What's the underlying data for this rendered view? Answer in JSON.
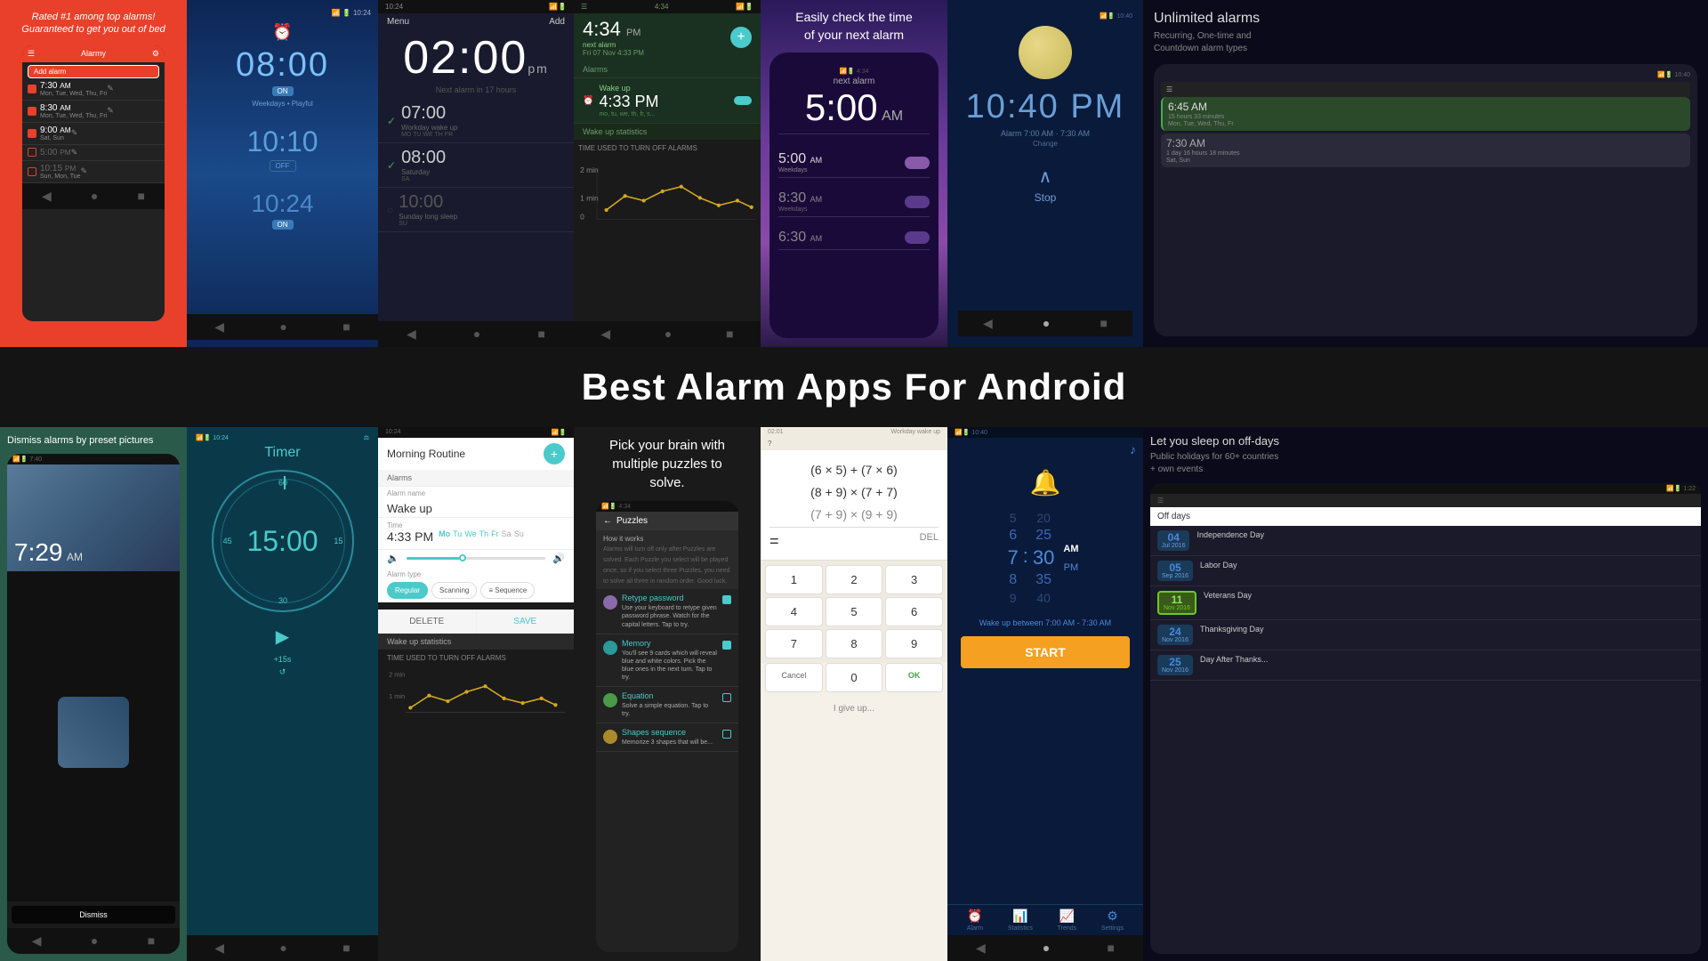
{
  "top": {
    "cell1": {
      "tagline": "Rated #1 among top alarms! Guaranteed to get you out of bed",
      "app_name": "Alarmy",
      "add_btn": "Add alarm",
      "alarms": [
        {
          "time": "7:30",
          "suffix": "AM",
          "days": "Mon, Tue, Wed, Thu, Fri",
          "checked": true
        },
        {
          "time": "8:30",
          "suffix": "AM",
          "days": "Mon, Tue, Wed, Thu, Fri",
          "checked": true
        },
        {
          "time": "9:00",
          "suffix": "AM",
          "days": "Sat, Sun",
          "checked": true
        },
        {
          "time": "5:00",
          "suffix": "PM",
          "days": "",
          "checked": false
        },
        {
          "time": "10:15",
          "suffix": "PM",
          "days": "Sun, Mon, Tue",
          "checked": false
        }
      ]
    },
    "cell2": {
      "time1": "08:00",
      "on1": "ON",
      "days1": "Weekdays • Playful",
      "time2": "10:10",
      "off": "OFF",
      "time3": "10:24",
      "on2": "ON"
    },
    "cell3": {
      "menu": "Menu",
      "add": "Add",
      "big_time": "02:00",
      "pm": "pm",
      "next_alarm": "Next alarm in 17 hours",
      "alarms": [
        {
          "time": "07:00",
          "label": "Workday wake up",
          "days": "MO TU WE TH FR",
          "checked": true
        },
        {
          "time": "08:00",
          "label": "Saturday",
          "days": "SA",
          "checked": true
        },
        {
          "time": "10:00",
          "label": "Sunday long sleep",
          "days": "SU",
          "checked": false
        }
      ]
    },
    "cell4": {
      "time": "4:34 PM",
      "next_alarm": "next alarm",
      "next_alarm_time": "Fri 07 Nov 4:33 PM",
      "alarms_label": "Alarms",
      "wakeup": "Wake up",
      "wakeup_time": "4:33 PM",
      "wakeup_days": "mo, tu, we, th, fr, s",
      "stats_label": "Wake up statistics",
      "chart_title": "TIME USED TO TURN OFF ALARMS"
    },
    "cell5": {
      "check_text": "Easily check the time\nof your next alarm",
      "big_time": "5:00",
      "am": "AM",
      "alarms": [
        {
          "time": "5:00",
          "suffix": "AM",
          "label": "Weekdays",
          "on": true
        },
        {
          "time": "8:30",
          "suffix": "AM",
          "label": "Weekdays",
          "on": false
        },
        {
          "time": "6:30",
          "suffix": "AM",
          "label": "",
          "on": false
        }
      ]
    },
    "cell6": {
      "moon": true,
      "big_time": "10:40 PM",
      "alarm_text": "Alarm 7:00 AM · 7:30 AM",
      "change": "Change",
      "stop": "Stop"
    },
    "cell7": {
      "unlimited": "Unlimited alarms",
      "subtitle": "Recurring, One-time and\nCountdown alarm types",
      "alarms": [
        {
          "time": "6:45 AM",
          "desc": "15 hours 33 minutes",
          "days": "Mon, Tue, Wed, Thu, Fr",
          "active": true
        },
        {
          "time": "7:30 AM",
          "desc": "1 day 16 hours 18 minutes",
          "days": "Sat, Sun",
          "active": false
        }
      ]
    }
  },
  "banner": {
    "title": "Best Alarm Apps For Android"
  },
  "bottom": {
    "cell1": {
      "dismiss_text": "Dismiss alarms by preset pictures",
      "time": "7:29",
      "am": "AM",
      "dismiss_btn": "Dismiss"
    },
    "cell2": {
      "timer_label": "Timer",
      "big_time": "15:00",
      "marks": [
        "60",
        "45",
        "30",
        "15"
      ],
      "plus15": "+15s"
    },
    "cell3": {
      "routine_name": "Morning Routine",
      "alarms_label": "Alarms",
      "alarm_name_label": "Alarm name",
      "alarm_name": "Wake up",
      "time_label": "Time",
      "time_value": "4:33 PM",
      "days": "Mo Tu We Th Fr Sa Su",
      "alarm_type_label": "Alarm type",
      "types": [
        "Regular",
        "Scanning",
        "Sequence"
      ],
      "delete_btn": "DELETE",
      "save_btn": "SAVE",
      "stats_label": "Wake up statistics",
      "chart_title": "TIME USED TO TURN OFF ALARMS"
    },
    "cell4": {
      "pick_brain": "Pick your brain with\nmultiple puzzles to\nsolve.",
      "puzzles_header": "Puzzles",
      "puzzles": [
        {
          "title": "Retype password",
          "desc": "Use your keyboard to retype given password phrase. Watch for the capital letters. Tap to try.",
          "checked": true
        },
        {
          "title": "Memory",
          "desc": "You'll see 9 cards which will reveal blue and white colors. Pick the blue ones in the next turn. Tap to try.",
          "checked": true
        },
        {
          "title": "Equation",
          "desc": "Solve a simple equation. Tap to try.",
          "checked": false
        },
        {
          "title": "Shapes sequence",
          "desc": "Memorize 3 shapes that will be",
          "checked": false
        }
      ]
    },
    "cell5": {
      "top_bar": "02:01",
      "workday": "Workday wake up",
      "math_eqs": [
        "(6 × 5) + (7 × 6)",
        "(8 + 9) × (7 + 7)",
        "(7 + 9) × (9 + 9)"
      ],
      "equals": "=",
      "del": "DEL",
      "numbers": [
        "1",
        "2",
        "3",
        "4",
        "5",
        "6",
        "7",
        "8",
        "9"
      ],
      "cancel": "Cancel",
      "zero": "0",
      "ok": "OK",
      "give_up": "I give up..."
    },
    "cell6": {
      "bell_icon": "🔔",
      "hours": [
        "5",
        "6",
        "7",
        "8",
        "9"
      ],
      "current_hour": "7",
      "minutes": [
        "20",
        "25",
        "30",
        "35",
        "40"
      ],
      "current_min": "30",
      "am_pm": [
        "AM",
        "PM"
      ],
      "current_ampm": "AM",
      "wake_between": "Wake up between 7:00 AM - 7:30 AM",
      "start_btn": "START",
      "tabs": [
        "Alarm",
        "Statistics",
        "Trends",
        "Settings"
      ]
    },
    "cell7": {
      "let_sleep": "Let you sleep on off-days",
      "public_holidays": "Public holidays for 60+ countries\n+ own events",
      "offdays_header": "Off days",
      "holidays": [
        {
          "day": "04",
          "month": "Jul 2016",
          "name": "Independence Day"
        },
        {
          "day": "05",
          "month": "Sep 2016",
          "name": "Labor Day"
        },
        {
          "day": "11",
          "month": "Nov 2016",
          "name": "Veterans Day"
        },
        {
          "day": "24",
          "month": "Nov 2016",
          "name": "Thanksgiving Day"
        },
        {
          "day": "25",
          "month": "Nov 2016",
          "name": "Day After Thanks..."
        }
      ]
    }
  },
  "icons": {
    "back": "◀",
    "home": "●",
    "recents": "■",
    "menu_dots": "⋮",
    "settings_gear": "⚙",
    "alarm_bell": "🔔",
    "plus": "+",
    "checkmark": "✓",
    "chevron_up": "^",
    "speaker": "🔊",
    "music": "♪"
  }
}
